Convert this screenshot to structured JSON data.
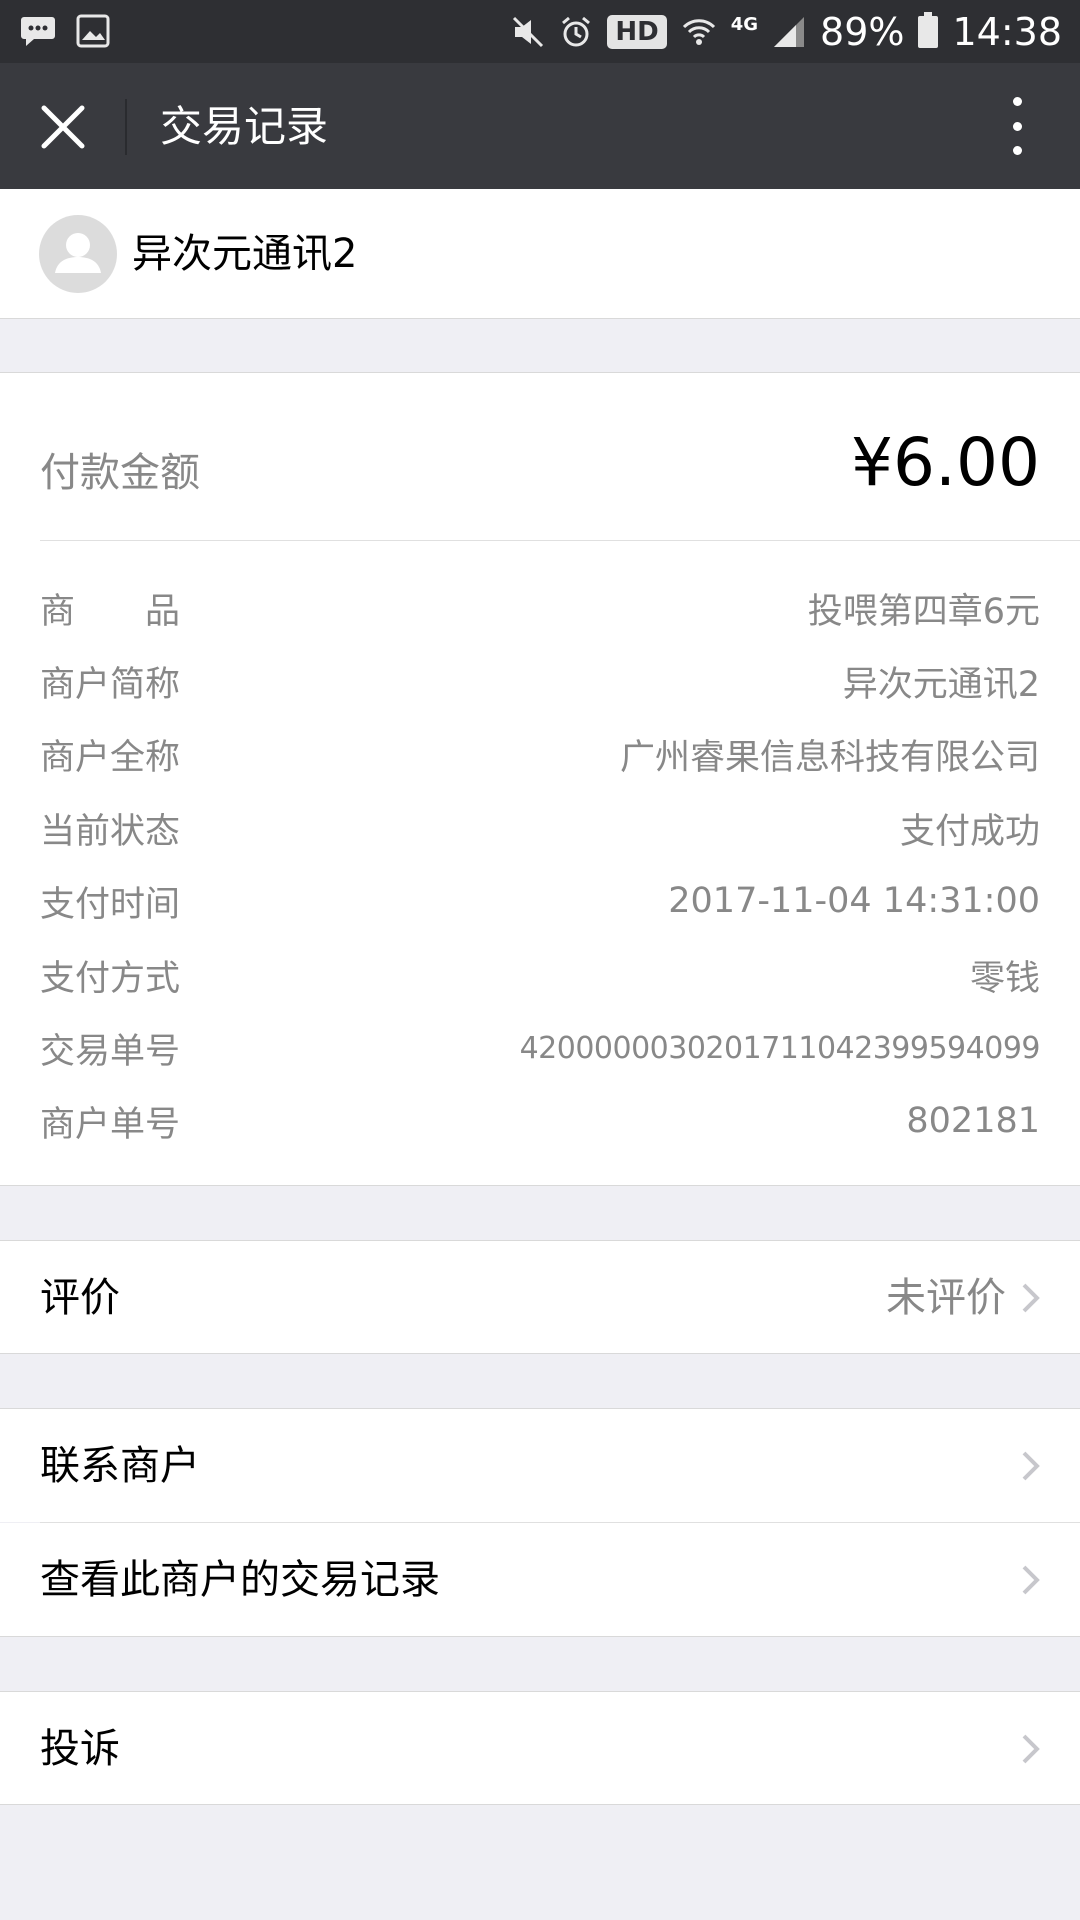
{
  "status_bar": {
    "battery_percent": "89%",
    "time": "14:38",
    "hd_badge": "HD",
    "network_type": "4G",
    "icons": [
      "chat-bubble-icon",
      "image-icon",
      "mute-icon",
      "alarm-icon",
      "hd-icon",
      "wifi-icon",
      "signal-icon",
      "battery-icon"
    ]
  },
  "nav": {
    "title": "交易记录",
    "close_icon": "close-icon",
    "more_icon": "more-vertical-icon"
  },
  "merchant": {
    "name": "异次元通讯2",
    "avatar_icon": "default-avatar-icon"
  },
  "payment": {
    "amount_label": "付款金额",
    "amount_value": "¥6.00",
    "rows": [
      {
        "label": "商　　品",
        "value": "投喂第四章6元"
      },
      {
        "label": "商户简称",
        "value": "异次元通讯2"
      },
      {
        "label": "商户全称",
        "value": "广州睿果信息科技有限公司"
      },
      {
        "label": "当前状态",
        "value": "支付成功"
      },
      {
        "label": "支付时间",
        "value": "2017-11-04 14:31:00"
      },
      {
        "label": "支付方式",
        "value": "零钱"
      },
      {
        "label": "交易单号",
        "value": "4200000030201711042399594099"
      },
      {
        "label": "商户单号",
        "value": "802181"
      }
    ]
  },
  "actions": {
    "review_label": "评价",
    "review_value": "未评价",
    "contact_label": "联系商户",
    "history_label": "查看此商户的交易记录",
    "complaint_label": "投诉"
  },
  "colors": {
    "status_bar_bg": "#2e2f33",
    "nav_bg": "#393a3f",
    "page_bg": "#efeff4",
    "secondary_text": "#888888"
  }
}
